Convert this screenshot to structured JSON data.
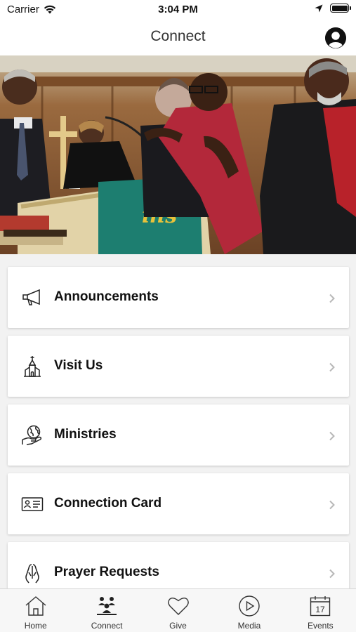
{
  "status_bar": {
    "carrier": "Carrier",
    "time": "3:04 PM"
  },
  "nav": {
    "title": "Connect"
  },
  "menu": [
    {
      "label": "Announcements",
      "icon": "megaphone-icon"
    },
    {
      "label": "Visit Us",
      "icon": "church-icon"
    },
    {
      "label": "Ministries",
      "icon": "globe-hand-icon"
    },
    {
      "label": "Connection Card",
      "icon": "id-card-icon"
    },
    {
      "label": "Prayer Requests",
      "icon": "praying-hands-icon"
    }
  ],
  "tabs": [
    {
      "label": "Home",
      "icon": "home-icon"
    },
    {
      "label": "Connect",
      "icon": "people-icon"
    },
    {
      "label": "Give",
      "icon": "heart-icon"
    },
    {
      "label": "Media",
      "icon": "play-icon"
    },
    {
      "label": "Events",
      "icon": "calendar-icon"
    }
  ],
  "events_icon_day": "17",
  "colors": {
    "accent": "#111111",
    "background": "#f2f2f2",
    "card": "#ffffff",
    "chevron": "#b8b8b8"
  }
}
